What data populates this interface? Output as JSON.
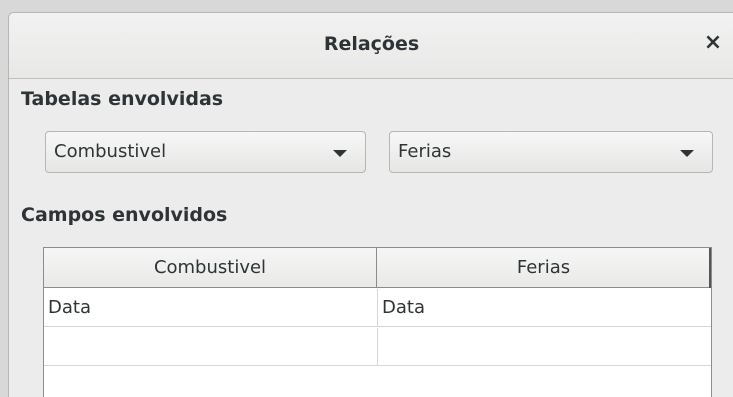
{
  "dialog": {
    "title": "Relações",
    "close_glyph": "×"
  },
  "tables_section": {
    "label": "Tabelas envolvidas",
    "left_table": "Combustivel",
    "right_table": "Ferias"
  },
  "fields_section": {
    "label": "Campos envolvidos",
    "columns": [
      "Combustivel",
      "Ferias"
    ],
    "rows": [
      [
        "Data",
        "Data"
      ],
      [
        "",
        ""
      ]
    ]
  }
}
